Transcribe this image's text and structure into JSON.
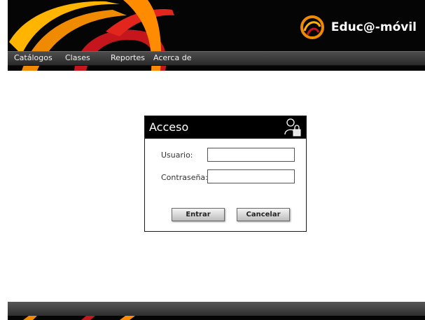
{
  "brand": {
    "name": "Educ@-móvil"
  },
  "nav": {
    "items": [
      {
        "label": "Catálogos"
      },
      {
        "label": "Clases"
      },
      {
        "label": "Reportes"
      },
      {
        "label": "Acerca de"
      }
    ]
  },
  "login": {
    "title": "Acceso",
    "username_label": "Usuario:",
    "username_value": "",
    "password_label": "Contraseña:",
    "password_value": "",
    "submit_label": "Entrar",
    "cancel_label": "Cancelar"
  },
  "icons": {
    "brand_logo": "swirl-logo-icon",
    "login_badge": "user-lock-icon"
  },
  "colors": {
    "header_bg": "#050505",
    "accent_orange": "#f08a00",
    "accent_yellow": "#ffb400",
    "accent_red": "#c4161c"
  }
}
